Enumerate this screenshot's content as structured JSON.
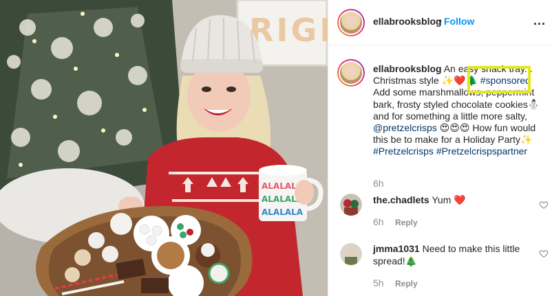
{
  "post": {
    "username": "ellabrooksblog",
    "follow_label": "Follow",
    "separator": "•",
    "more_label": "...",
    "caption": {
      "username": "ellabrooksblog",
      "text_1": " An easy snack tray... Christmas style",
      "emoji_1": "✨❤️🌲",
      "hashtag_sponsored": "#sponsored",
      "text_2": " Add some marshmallows, peppermint bark, frosty styled chocolate cookies",
      "emoji_2": "⛄",
      "text_3": " and for something a little more salty, ",
      "mention": "@pretzelcrisps",
      "emoji_3": " 😍😍😍",
      "text_4": " How fun would this be to make for a Holiday Party",
      "emoji_4": "✨ ",
      "hashtag_1": "#Pretzelcrisps",
      "hashtag_2": "#Pretzelcrispspartner"
    },
    "caption_time": "6h",
    "colors": {
      "link": "#00376b",
      "follow": "#0095f6",
      "highlight": "#e4e81b",
      "heart": "#ed4956"
    }
  },
  "comments": [
    {
      "username": "the.chadlets",
      "text": " Yum ❤️",
      "time": "6h",
      "reply": "Reply"
    },
    {
      "username": "jmma1031",
      "text": " Need to make this little spread!🎄",
      "time": "5h",
      "reply": "Reply"
    }
  ],
  "photo": {
    "sign_text": "RIGH",
    "mug_text": "ALALALA"
  }
}
